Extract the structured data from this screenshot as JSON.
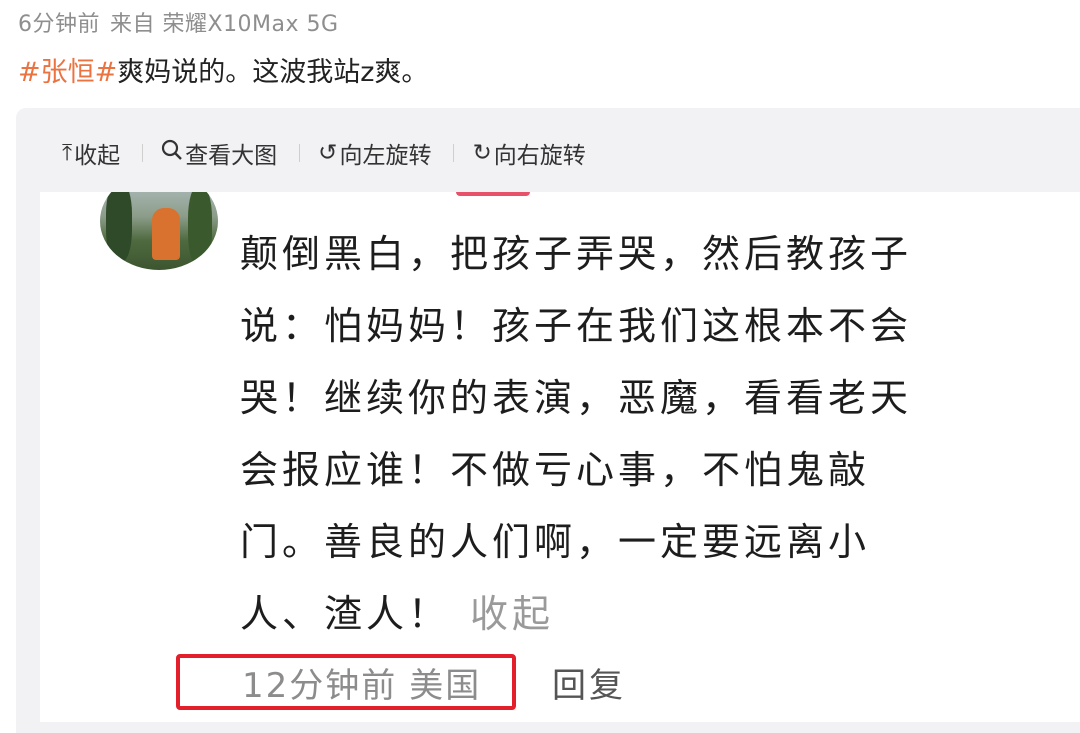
{
  "post": {
    "time": "6分钟前",
    "source": "来自 荣耀X10Max 5G",
    "topic": "#张恒#",
    "text": "爽妈说的。这波我站z爽。"
  },
  "toolbar": {
    "collapse_label": "收起",
    "view_large_label": "查看大图",
    "rotate_left_label": "向左旋转",
    "rotate_right_label": "向右旋转"
  },
  "icons": {
    "collapse": "upload-arrow-icon",
    "view_large": "magnifier-icon",
    "rotate_left": "rotate-left-icon",
    "rotate_right": "rotate-right-icon"
  },
  "screenshot_comment": {
    "lines": [
      "颠倒黑白，把孩子弄哭，然后教孩子",
      "说：怕妈妈！孩子在我们这根本不会",
      "哭！继续你的表演，恶魔，看看老天",
      "会报应谁！不做亏心事，不怕鬼敲",
      "门。善良的人们啊，一定要远离小",
      "人、渣人！"
    ],
    "collapse_label": "收起",
    "time": "12分钟前",
    "location": "美国",
    "reply_label": "回复"
  },
  "colors": {
    "topic": "#eb7340",
    "highlight_box": "#e21f2b",
    "card_bg": "#f2f2f5"
  }
}
